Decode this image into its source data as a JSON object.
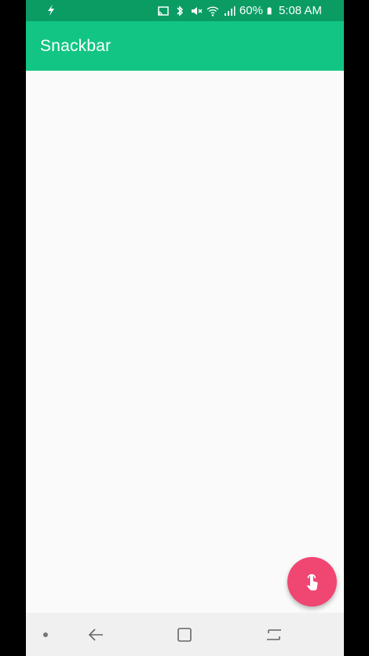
{
  "status_bar": {
    "battery_percent": "60%",
    "time": "5:08 AM",
    "icons": [
      "flash-icon",
      "cast-icon",
      "bluetooth-icon",
      "mute-icon",
      "wifi-icon",
      "signal-icon",
      "battery-icon"
    ]
  },
  "app_bar": {
    "title": "Snackbar",
    "color": "#12c585"
  },
  "fab": {
    "icon": "touch-gesture-icon",
    "color": "#ef4672"
  },
  "nav_bar": {
    "icons": [
      "dot-icon",
      "back-icon",
      "home-icon",
      "recents-icon"
    ]
  }
}
